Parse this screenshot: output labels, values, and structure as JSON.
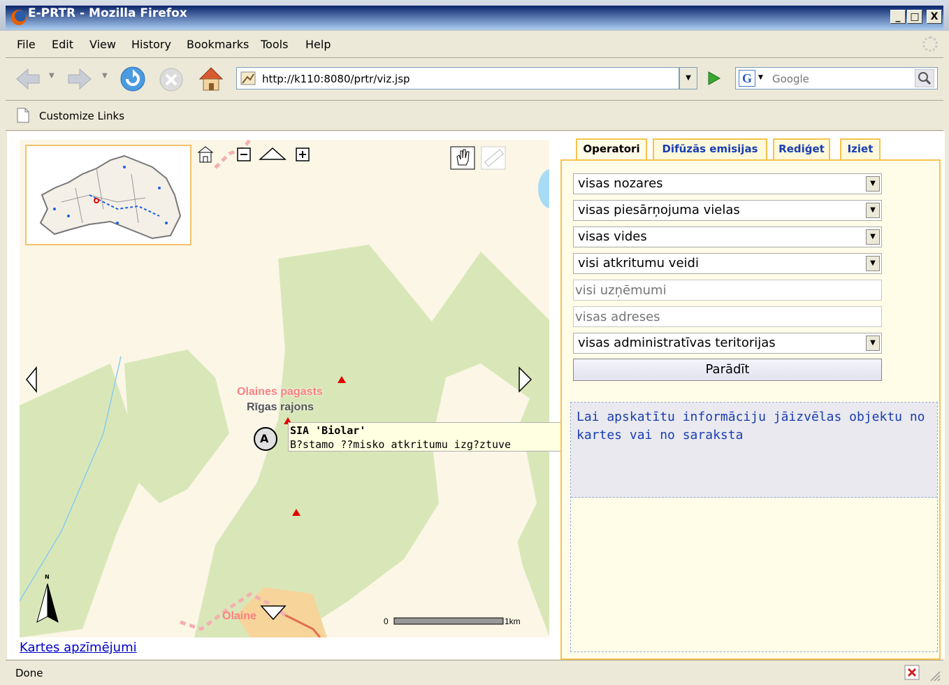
{
  "window": {
    "title": "E-PRTR - Mozilla Firefox",
    "min_label": "_",
    "max_label": "□",
    "close_label": "X"
  },
  "menu": [
    "File",
    "Edit",
    "View",
    "History",
    "Bookmarks",
    "Tools",
    "Help"
  ],
  "nav": {
    "url": "http://k110:8080/prtr/viz.jsp",
    "search_placeholder": "Google"
  },
  "bookmarks": {
    "customize_label": "Customize Links"
  },
  "map": {
    "labels": {
      "place1": "Olaines pagasts",
      "place2": "Rīgas rajons",
      "place3": "Olaine"
    },
    "scale": {
      "start": "0",
      "end": "1km"
    },
    "north": "N",
    "marker_letter": "A",
    "tooltip": {
      "title": "SIA 'Biolar'",
      "subtitle": "B?stamo ??misko atkritumu izg?ztuve"
    },
    "legend_link": "Kartes apzīmējumi"
  },
  "tabs": [
    "Operatori",
    "Difūzās emisijas",
    "Rediģet",
    "Iziet"
  ],
  "filters": {
    "selects": [
      "visas nozares",
      "visas piesārņojuma vielas",
      "visas vides",
      "visi atkritumu veidi"
    ],
    "company_placeholder": "visi uzņēmumi",
    "address_placeholder": "visas adreses",
    "territory_select": "visas administratīvas teritorijas",
    "show_button": "Parādīt"
  },
  "info_text": "Lai apskatītu informāciju jāizvēlas objektu no kartes vai no saraksta",
  "status": {
    "text": "Done"
  }
}
